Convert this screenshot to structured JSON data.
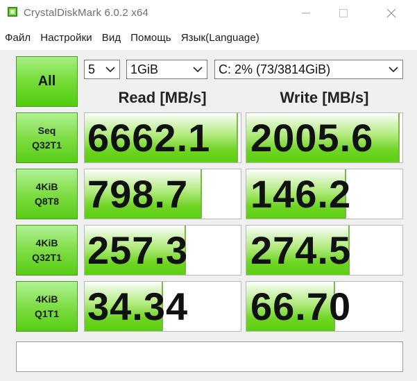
{
  "window": {
    "title": "CrystalDiskMark 6.0.2 x64",
    "icon": "crystaldiskmark-app-icon"
  },
  "menu": [
    {
      "label": "Файл"
    },
    {
      "label": "Настройки"
    },
    {
      "label": "Вид"
    },
    {
      "label": "Помощь"
    },
    {
      "label": "Язык(Language)"
    }
  ],
  "controls": {
    "all_label": "All",
    "count": "5",
    "size": "1GiB",
    "drive": "C: 2% (73/3814GiB)"
  },
  "headers": {
    "read": "Read [MB/s]",
    "write": "Write [MB/s]"
  },
  "rows": [
    {
      "line1": "Seq",
      "line2": "Q32T1",
      "read": "6662.1",
      "write": "2005.6",
      "read_fill": 0.98,
      "write_fill": 0.98
    },
    {
      "line1": "4KiB",
      "line2": "Q8T8",
      "read": "798.7",
      "write": "146.2",
      "read_fill": 0.75,
      "write_fill": 0.64
    },
    {
      "line1": "4KiB",
      "line2": "Q32T1",
      "read": "257.3",
      "write": "274.5",
      "read_fill": 0.65,
      "write_fill": 0.66
    },
    {
      "line1": "4KiB",
      "line2": "Q1T1",
      "read": "34.34",
      "write": "66.70",
      "read_fill": 0.5,
      "write_fill": 0.57
    }
  ],
  "comment": "",
  "colors": {
    "accent_green": "#56cd14",
    "bar_green": "#6fd424"
  }
}
